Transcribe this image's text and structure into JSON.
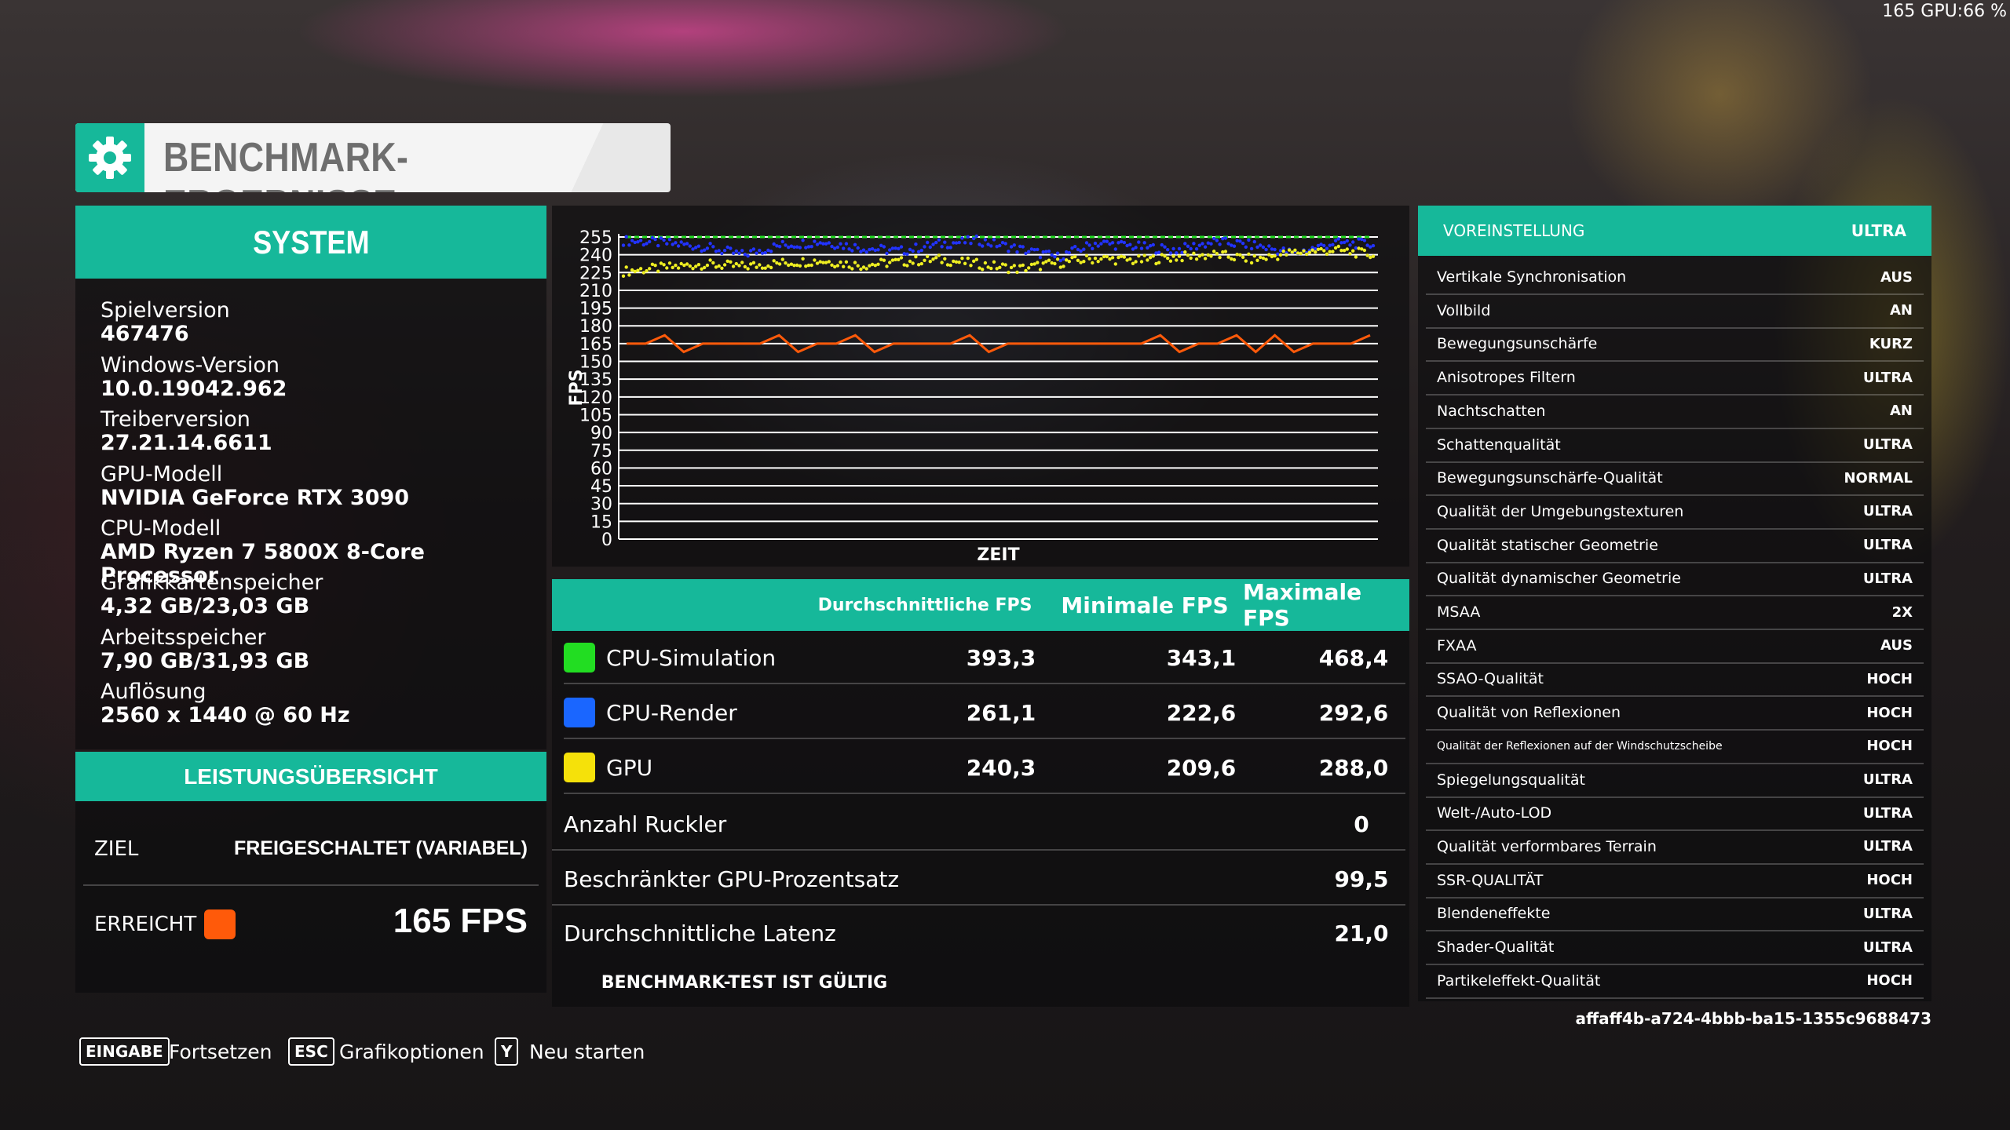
{
  "overlay": "165 GPU:66 %",
  "header": {
    "title": "BENCHMARK-ERGEBNISSE",
    "icon": "gear-icon"
  },
  "system": {
    "title": "SYSTEM",
    "rows": [
      {
        "label": "Spielversion",
        "value": "467476"
      },
      {
        "label": "Windows-Version",
        "value": "10.0.19042.962"
      },
      {
        "label": "Treiberversion",
        "value": "27.21.14.6611"
      },
      {
        "label": "GPU-Modell",
        "value": "NVIDIA GeForce RTX 3090"
      },
      {
        "label": "CPU-Modell",
        "value": "AMD Ryzen 7 5800X 8-Core Processor"
      },
      {
        "label": "Grafikkartenspeicher",
        "value": "4,32 GB/23,03 GB"
      },
      {
        "label": "Arbeitsspeicher",
        "value": "7,90 GB/31,93 GB"
      },
      {
        "label": "Auflösung",
        "value": "2560 x 1440 @ 60 Hz"
      }
    ]
  },
  "performance": {
    "title": "LEISTUNGSÜBERSICHT",
    "target_label": "ZIEL",
    "target_value": "FREIGESCHALTET (VARIABEL)",
    "achieved_label": "ERREICHT",
    "achieved_value": "165 FPS",
    "achieved_color": "#ff5a0a"
  },
  "chart_data": {
    "type": "scatter",
    "ylabel": "FPS",
    "xlabel": "ZEIT",
    "yticks": [
      0,
      15,
      30,
      45,
      60,
      75,
      90,
      105,
      120,
      135,
      150,
      165,
      180,
      195,
      210,
      225,
      240,
      255
    ],
    "ylim": [
      0,
      255
    ],
    "grid": true,
    "series": [
      {
        "name": "CPU-Simulation",
        "color": "#22dd22",
        "style": "line",
        "values": [
          255,
          255,
          255,
          255,
          255,
          255,
          255,
          255,
          255,
          255
        ]
      },
      {
        "name": "CPU-Render",
        "color": "#2233ff",
        "style": "scatter",
        "values": [
          252,
          250,
          247,
          240,
          248,
          251,
          246,
          243,
          249,
          252,
          245,
          238,
          250,
          247,
          244,
          251,
          248,
          241,
          250,
          249
        ]
      },
      {
        "name": "GPU",
        "color": "#eeee22",
        "style": "scatter",
        "values": [
          226,
          229,
          232,
          230,
          233,
          235,
          231,
          234,
          236,
          232,
          228,
          233,
          237,
          235,
          238,
          240,
          236,
          242,
          244,
          240
        ]
      },
      {
        "name": "ERREICHT",
        "color": "#ff5a0a",
        "style": "line",
        "values": [
          165,
          165,
          172,
          158,
          165,
          165,
          165,
          165,
          172,
          158,
          165,
          165,
          172,
          158,
          165,
          165,
          165,
          165,
          172,
          158,
          165,
          165,
          165,
          165,
          165,
          165,
          165,
          165,
          172,
          158,
          165,
          165,
          172,
          158,
          172,
          158,
          165,
          165,
          165,
          172
        ]
      }
    ]
  },
  "table": {
    "headers": [
      "Durchschnittliche FPS",
      "Minimale FPS",
      "Maximale FPS"
    ],
    "rows": [
      {
        "name": "CPU-Simulation",
        "color": "#22dd22",
        "avg": "393,3",
        "min": "343,1",
        "max": "468,4"
      },
      {
        "name": "CPU-Render",
        "color": "#1a66ff",
        "avg": "261,1",
        "min": "222,6",
        "max": "292,6"
      },
      {
        "name": "GPU",
        "color": "#f5e10a",
        "avg": "240,3",
        "min": "209,6",
        "max": "288,0"
      }
    ],
    "stats": [
      {
        "name": "Anzahl Ruckler",
        "value": "0"
      },
      {
        "name": "Beschränkter GPU-Prozentsatz",
        "value": "99,5"
      },
      {
        "name": "Durchschnittliche Latenz",
        "value": "21,0"
      }
    ],
    "valid_text": "BENCHMARK-TEST IST GÜLTIG"
  },
  "settings": {
    "preset_label": "VOREINSTELLUNG",
    "preset_value": "ULTRA",
    "rows": [
      {
        "label": "Vertikale Synchronisation",
        "value": "AUS"
      },
      {
        "label": "Vollbild",
        "value": "AN"
      },
      {
        "label": "Bewegungsunschärfe",
        "value": "KURZ"
      },
      {
        "label": "Anisotropes Filtern",
        "value": "ULTRA"
      },
      {
        "label": "Nachtschatten",
        "value": "AN"
      },
      {
        "label": "Schattenqualität",
        "value": "ULTRA"
      },
      {
        "label": "Bewegungsunschärfe-Qualität",
        "value": "NORMAL"
      },
      {
        "label": "Qualität der Umgebungstexturen",
        "value": "ULTRA"
      },
      {
        "label": "Qualität statischer Geometrie",
        "value": "ULTRA"
      },
      {
        "label": "Qualität dynamischer Geometrie",
        "value": "ULTRA"
      },
      {
        "label": "MSAA",
        "value": "2X"
      },
      {
        "label": "FXAA",
        "value": "AUS"
      },
      {
        "label": "SSAO-Qualität",
        "value": "HOCH"
      },
      {
        "label": "Qualität von Reflexionen",
        "value": "HOCH"
      },
      {
        "label": "Qualität der Reflexionen auf der Windschutzscheibe",
        "value": "HOCH"
      },
      {
        "label": "Spiegelungsqualität",
        "value": "ULTRA"
      },
      {
        "label": "Welt-/Auto-LOD",
        "value": "ULTRA"
      },
      {
        "label": "Qualität verformbares Terrain",
        "value": "ULTRA"
      },
      {
        "label": "SSR-QUALITÄT",
        "value": "HOCH"
      },
      {
        "label": "Blendeneffekte",
        "value": "ULTRA"
      },
      {
        "label": "Shader-Qualität",
        "value": "ULTRA"
      },
      {
        "label": "Partikeleffekt-Qualität",
        "value": "HOCH"
      }
    ]
  },
  "hash": "affaff4b-a724-4bbb-ba15-1355c9688473",
  "footer": [
    {
      "key": "EINGABE",
      "label": "Fortsetzen"
    },
    {
      "key": "ESC",
      "label": "Grafikoptionen"
    },
    {
      "key": "Y",
      "label": "Neu starten"
    }
  ]
}
